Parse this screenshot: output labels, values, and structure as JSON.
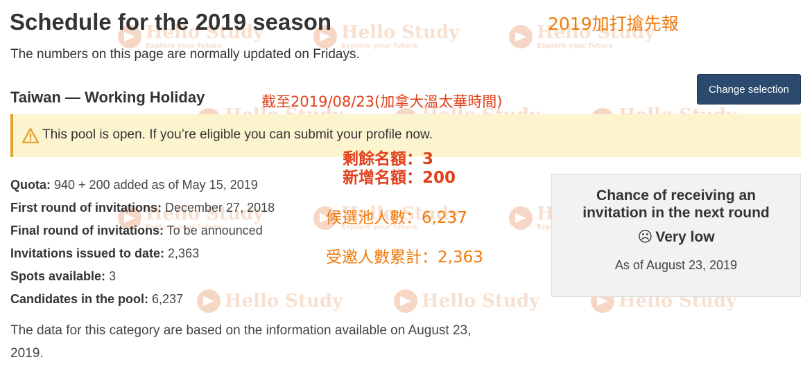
{
  "page": {
    "title": "Schedule for the 2019 season",
    "subtitle": "The numbers on this page are normally updated on Fridays."
  },
  "category": {
    "heading": "Taiwan — Working Holiday",
    "change_button_label": "Change selection"
  },
  "alert": {
    "icon": "warning-icon",
    "text": "This pool is open. If you’re eligible you can submit your profile now."
  },
  "facts": [
    {
      "label": "Quota:",
      "value": "940 + 200 added as of May 15, 2019"
    },
    {
      "label": "First round of invitations:",
      "value": "December 27, 2018"
    },
    {
      "label": "Final round of invitations:",
      "value": "To be announced"
    },
    {
      "label": "Invitations issued to date:",
      "value": "2,363"
    },
    {
      "label": "Spots available:",
      "value": "3"
    },
    {
      "label": "Candidates in the pool:",
      "value": "6,237"
    }
  ],
  "note": "The data for this category are based on the information available on August 23, 2019.",
  "chance": {
    "heading": "Chance of receiving an invitation in the next round",
    "icon": "frown-icon",
    "level": "Very low",
    "as_of": "As of August 23, 2019"
  },
  "annotations": {
    "headline": "2019加打搶先報",
    "as_of": "截至2019/08/23(加拿大溫太華時間)",
    "remaining": "剩餘名額：3",
    "added": "新增名額：200",
    "pool": "候選池人數：6,237",
    "invited": "受邀人數累計：2,363"
  },
  "watermark": {
    "brand": "Hello Study",
    "tagline": "Explore your future"
  },
  "colors": {
    "button_bg": "#2c4a6e",
    "alert_bg": "#fcf4cf",
    "alert_border": "#e5a130",
    "annotation_orange": "#f07a0a",
    "annotation_red": "#e2401a",
    "card_bg": "#f2f2f2"
  }
}
